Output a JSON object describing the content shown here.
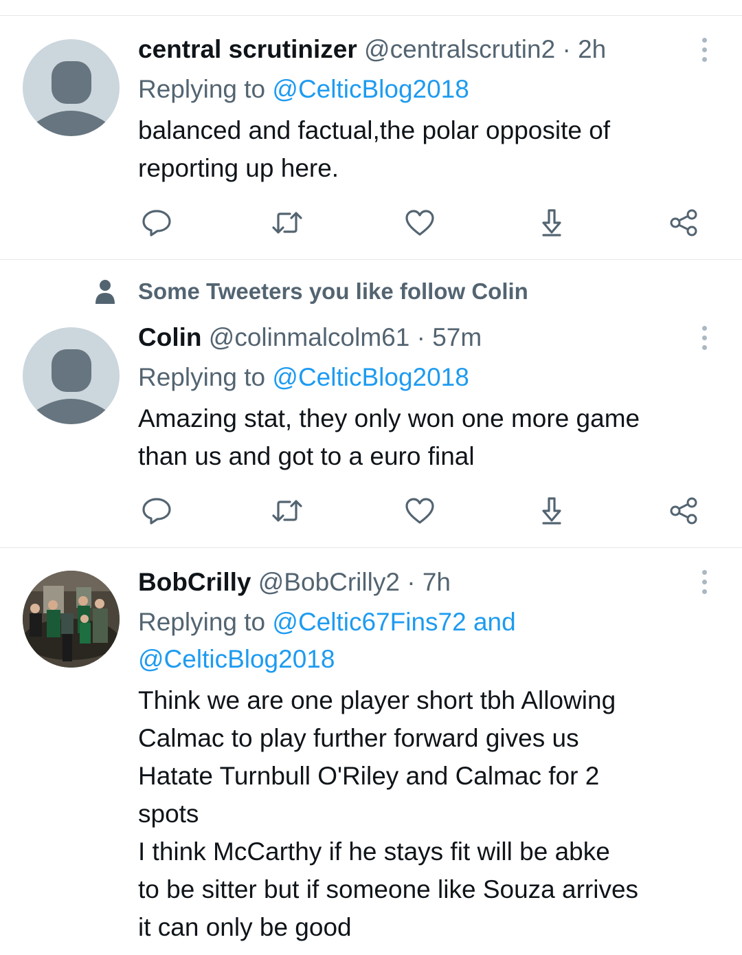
{
  "tweets": [
    {
      "name": "central scrutinizer",
      "handle": "@centralscrutin2",
      "time": "2h",
      "replying_prefix": "Replying to ",
      "replying_to": "@CelticBlog2018",
      "replying_to_line2": "",
      "text": [
        "balanced and factual,the polar opposite of",
        "reporting up here."
      ]
    },
    {
      "name": "Colin",
      "handle": "@colinmalcolm61",
      "time": "57m",
      "replying_prefix": "Replying to ",
      "replying_to": "@CelticBlog2018",
      "replying_to_line2": "",
      "text": [
        "Amazing stat, they only won one more game",
        "than us and got to a euro final"
      ]
    },
    {
      "name": "BobCrilly",
      "handle": "@BobCrilly2",
      "time": "7h",
      "replying_prefix": "Replying to ",
      "replying_to": "@Celtic67Fins72 and",
      "replying_to_line2": "@CelticBlog2018",
      "text": [
        "Think we are one player short tbh Allowing",
        "Calmac to play further forward gives us",
        "Hatate Turnbull O'Riley and Calmac for 2",
        "spots",
        "I think McCarthy if he stays fit will be abke",
        "to be sitter but if someone like Souza arrives",
        "it can only be good"
      ]
    }
  ],
  "social_context": "Some Tweeters you like follow Colin",
  "colors": {
    "link": "#1d9bf0",
    "secondary": "#536471",
    "primary": "#0f1419",
    "icon": "#536471"
  },
  "icons": [
    "reply-icon",
    "retweet-icon",
    "like-icon",
    "share-icon",
    "share-via-icon",
    "more-icon",
    "person-icon"
  ]
}
